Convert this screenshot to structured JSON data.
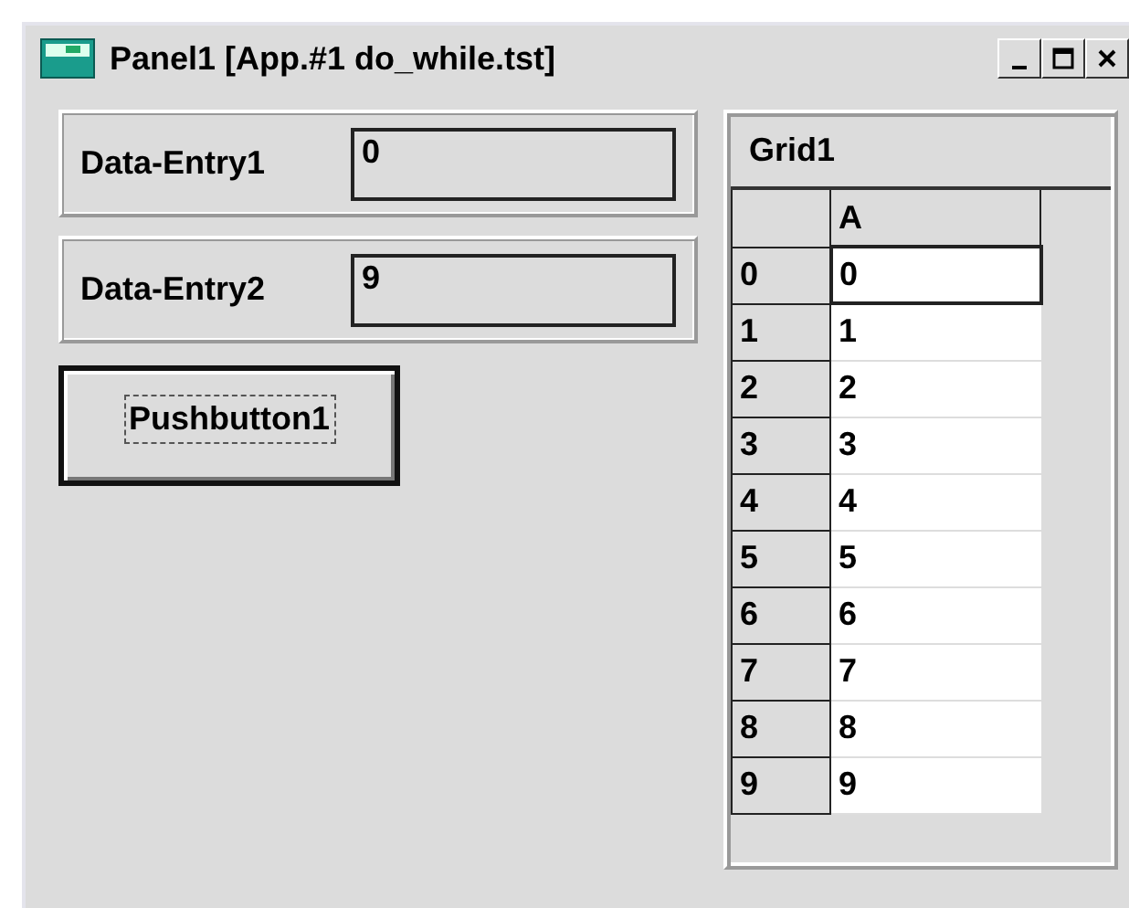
{
  "window": {
    "title": "Panel1 [App.#1 do_while.tst]"
  },
  "entries": [
    {
      "label": "Data-Entry1",
      "value": "0"
    },
    {
      "label": "Data-Entry2",
      "value": "9"
    }
  ],
  "button": {
    "label": "Pushbutton1",
    "focused": true
  },
  "grid": {
    "title": "Grid1",
    "columns": [
      "A"
    ],
    "rows": [
      {
        "header": "0",
        "cells": [
          "0"
        ],
        "selected": true
      },
      {
        "header": "1",
        "cells": [
          "1"
        ],
        "selected": false
      },
      {
        "header": "2",
        "cells": [
          "2"
        ],
        "selected": false
      },
      {
        "header": "3",
        "cells": [
          "3"
        ],
        "selected": false
      },
      {
        "header": "4",
        "cells": [
          "4"
        ],
        "selected": false
      },
      {
        "header": "5",
        "cells": [
          "5"
        ],
        "selected": false
      },
      {
        "header": "6",
        "cells": [
          "6"
        ],
        "selected": false
      },
      {
        "header": "7",
        "cells": [
          "7"
        ],
        "selected": false
      },
      {
        "header": "8",
        "cells": [
          "8"
        ],
        "selected": false
      },
      {
        "header": "9",
        "cells": [
          "9"
        ],
        "selected": false
      }
    ]
  }
}
